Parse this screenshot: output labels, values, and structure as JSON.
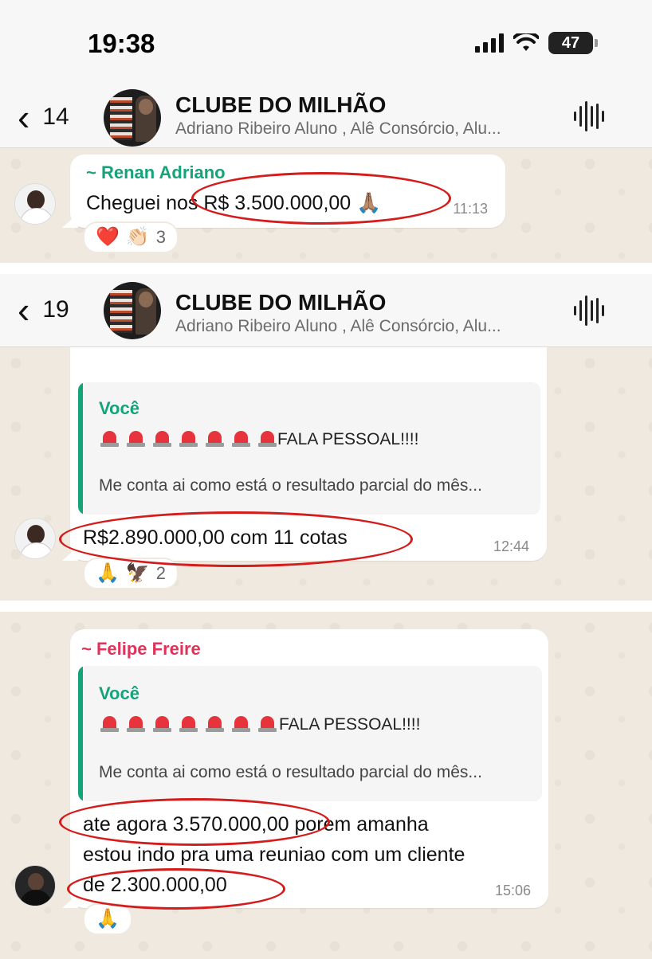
{
  "status_bar": {
    "time": "19:38",
    "battery": "47"
  },
  "header1": {
    "unread": "14",
    "title": "CLUBE DO MILHÃO",
    "members": "Adriano Ribeiro Aluno , Alê Consórcio, Alu..."
  },
  "msg1": {
    "sender": "~ Renan Adriano",
    "text": "Cheguei nos R$ 3.500.000,00 🙏🏽",
    "time": "11:13",
    "reaction1": "❤️",
    "reaction2": "👏🏻",
    "reaction_count": "3"
  },
  "header2": {
    "unread": "19",
    "title": "CLUBE DO MILHÃO",
    "members": "Adriano Ribeiro Aluno , Alê Consórcio, Alu..."
  },
  "msg2": {
    "quote_author": "Você",
    "quote_head": "FALA PESSOAL!!!!",
    "quote_text": "Me conta ai como está o resultado parcial do mês...",
    "text": "R$2.890.000,00 com 11 cotas",
    "time": "12:44",
    "reaction1": "🙏",
    "reaction2": "🦅",
    "reaction_count": "2"
  },
  "msg3": {
    "sender": "~ Felipe Freire",
    "quote_author": "Você",
    "quote_head": "FALA PESSOAL!!!!",
    "quote_text": "Me conta ai como está o resultado parcial do mês...",
    "line1": "ate agora 3.570.000,00 porem amanha",
    "line2": "estou indo pra uma reuniao com um cliente",
    "line3": "de 2.300.000,00",
    "time": "15:06",
    "reaction1": "🙏"
  },
  "colors": {
    "accent_green": "#15a37a",
    "sender_green": "#15a37a",
    "sender_red": "#e0325a",
    "highlight": "#d41c1c",
    "chat_bg": "#efe9df"
  }
}
